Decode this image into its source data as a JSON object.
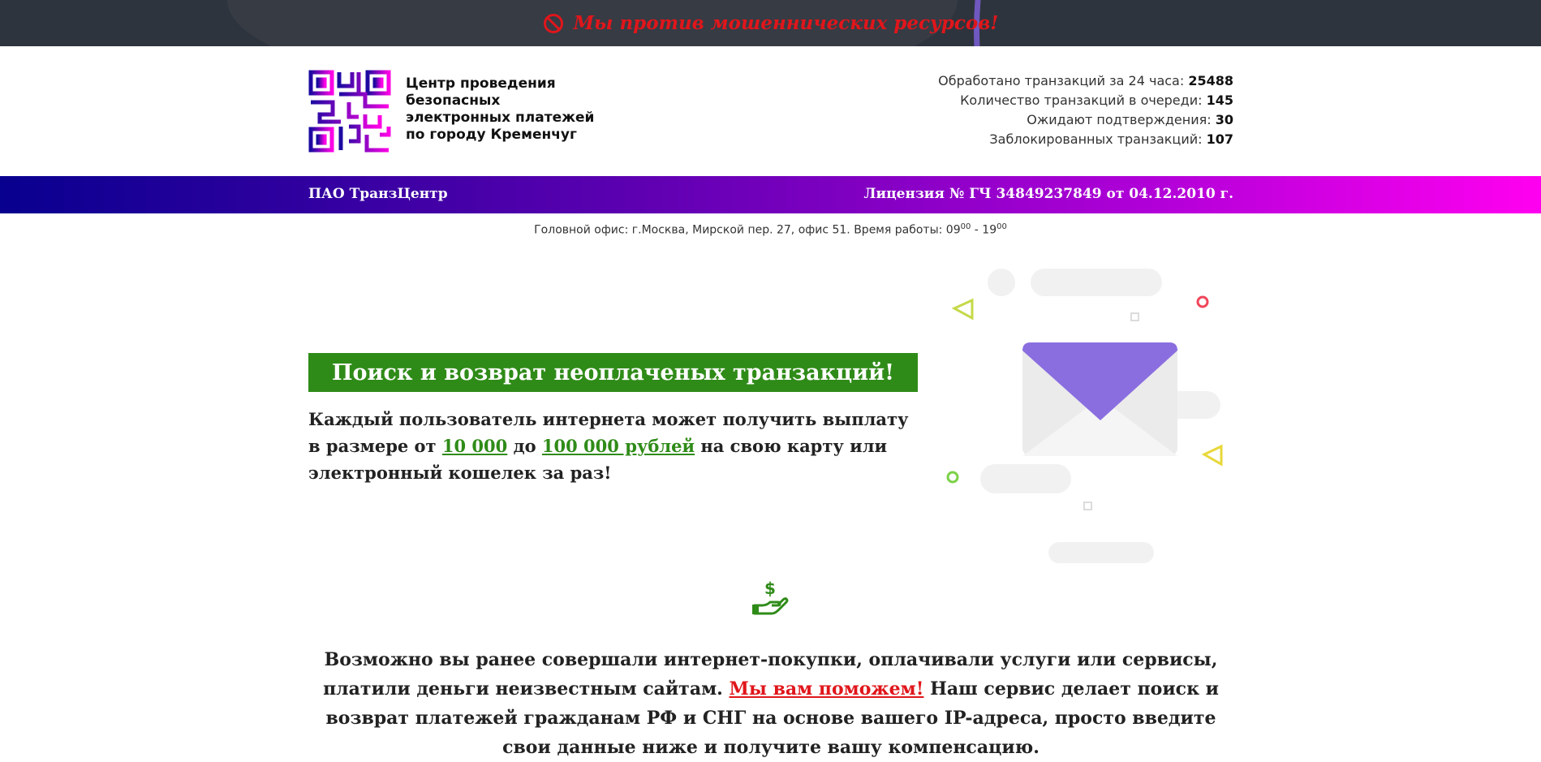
{
  "banner": {
    "warning": "Мы против мошеннических ресурсов!"
  },
  "header": {
    "brand_lines": [
      "Центр проведения",
      "безопасных",
      "электронных платежей",
      "по городу Кременчуг"
    ],
    "stats": [
      {
        "label": "Обработано транзакций за 24 часа:",
        "value": "25488"
      },
      {
        "label": "Количество транзакций в очереди:",
        "value": "145"
      },
      {
        "label": "Ожидают подтверждения:",
        "value": "30"
      },
      {
        "label": "Заблокированных транзакций:",
        "value": "107"
      }
    ]
  },
  "band": {
    "company": "ПАО ТранзЦентр",
    "license": "Лицензия № ГЧ 34849237849 от 04.12.2010 г."
  },
  "office": {
    "text": "Головной офис: г.Москва, Мирской пер. 27, офис 51. Время работы: 09",
    "open_sup": "00",
    "dash": " - 19",
    "close_sup": "00"
  },
  "hero": {
    "title": "Поиск и возврат неоплаченых транзакций!",
    "text_1": "Каждый пользователь интернета может получить выплату в размере от ",
    "link_1": "10 000",
    "text_2": " до ",
    "link_2": "100 000 рублей",
    "text_3": " на свою карту или электронный кошелек за раз!"
  },
  "info": {
    "text_1": "Возможно вы ранее совершали интернет-покупки, оплачивали услуги или сервисы, платили деньги неизвестным сайтам. ",
    "link": "Мы вам поможем!",
    "text_2": " Наш сервис делает поиск и возврат платежей гражданам РФ и СНГ на основе вашего IP-адреса, просто введите свои данные ниже и получите вашу компенсацию."
  },
  "colors": {
    "accent_green": "#2f8b18",
    "warning_red": "#e0161b",
    "band_start": "#08008f",
    "band_end": "#ff00f0"
  },
  "icons": [
    "ban-icon",
    "qr-logo-icon",
    "envelope-illustration",
    "money-hand-icon"
  ]
}
